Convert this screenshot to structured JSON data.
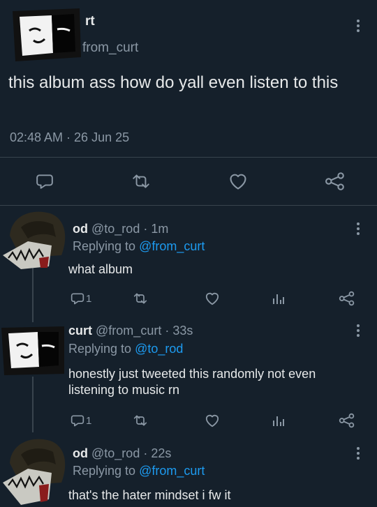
{
  "main_tweet": {
    "display_name": "rt",
    "handle": "from_curt",
    "text": "this album ass how do yall even listen to this",
    "timestamp": "02:48 AM · 26 Jun 25",
    "icons": [
      "reply-icon",
      "retweet-icon",
      "like-icon",
      "share-icon",
      "more-icon"
    ]
  },
  "replies": [
    {
      "name": "od",
      "handle": "@to_rod",
      "time": "· 1m",
      "replying_label": "Replying to",
      "replying_to": "@from_curt",
      "text": "what album",
      "reply_count": "1"
    },
    {
      "name": "curt",
      "handle": "@from_curt",
      "time": "· 33s",
      "replying_label": "Replying to",
      "replying_to": "@to_rod",
      "text": "honestly just tweeted this randomly not even listening to music rn",
      "reply_count": "1"
    },
    {
      "name": "od",
      "handle": "@to_rod",
      "time": "· 22s",
      "replying_label": "Replying to",
      "replying_to": "@from_curt",
      "text": "that's the hater mindset i fw it"
    }
  ],
  "colors": {
    "background": "#15202b",
    "text": "#e7e9ea",
    "muted": "#8b98a5",
    "link": "#1d9bf0",
    "divider": "#38444d"
  }
}
